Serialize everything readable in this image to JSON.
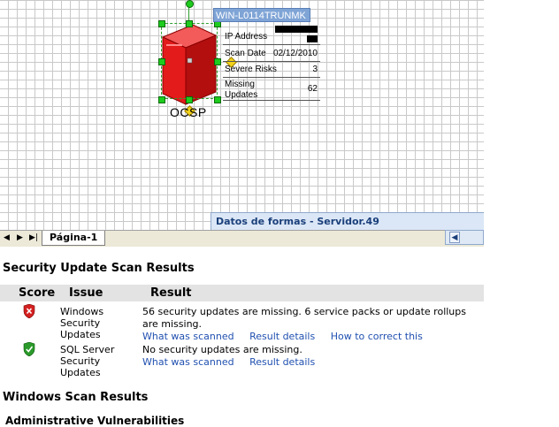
{
  "diagram": {
    "host_name": "WIN-L0114TRUNMK",
    "server_label": "OCSP",
    "fields": [
      {
        "label": "IP Address",
        "value": ""
      },
      {
        "label": "Scan Date",
        "value": "02/12/2010"
      },
      {
        "label": "Severe Risks",
        "value": "3"
      },
      {
        "label": "Missing Updates",
        "value": "62"
      }
    ],
    "shape_data_title": "Datos de formas - Servidor.49"
  },
  "tabs": {
    "page_tab": "Página-1"
  },
  "report": {
    "title": "Security Update Scan Results",
    "columns": [
      "Score",
      "Issue",
      "Result"
    ],
    "rows": [
      {
        "status": "fail",
        "issue": "Windows Security Updates",
        "result": "56 security updates are missing. 6 service packs or update rollups are missing.",
        "links": [
          "What was scanned",
          "Result details",
          "How to correct this"
        ]
      },
      {
        "status": "pass",
        "issue": "SQL Server Security Updates",
        "result": "No security updates are missing.",
        "links": [
          "What was scanned",
          "Result details"
        ]
      }
    ],
    "section2_title": "Windows Scan Results",
    "section2_subtitle": "Administrative Vulnerabilities"
  },
  "colors": {
    "server_red": "#e31b1b",
    "fail_shield": "#d42020",
    "pass_shield": "#2a9a2a",
    "link_blue": "#2050b0"
  }
}
